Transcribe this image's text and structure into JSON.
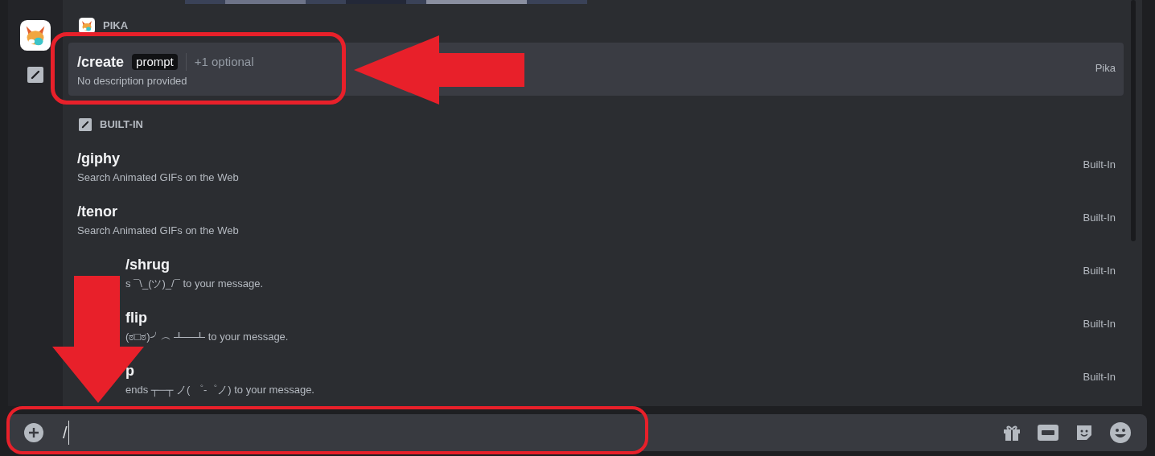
{
  "sections": [
    {
      "title": "PIKA",
      "kind": "app",
      "commands": [
        {
          "name": "/create",
          "option": "prompt",
          "extra": "+1 optional",
          "description": "No description provided",
          "source": "Pika",
          "selected": true,
          "covered": false
        }
      ]
    },
    {
      "title": "BUILT-IN",
      "kind": "builtin",
      "commands": [
        {
          "name": "/giphy",
          "description": "Search Animated GIFs on the Web",
          "source": "Built-In",
          "selected": false,
          "covered": false
        },
        {
          "name": "/tenor",
          "description": "Search Animated GIFs on the Web",
          "source": "Built-In",
          "selected": false,
          "covered": false
        },
        {
          "name": "/shrug",
          "description": "s ¯\\_(ツ)_/¯ to your message.",
          "source": "Built-In",
          "selected": false,
          "covered": true
        },
        {
          "name": "flip",
          "description": "(ಠ□ಠ)╯︵ ┻━┻ to your message.",
          "source": "Built-In",
          "selected": false,
          "covered": true
        },
        {
          "name": "p",
          "description": "ends ┬─┬ ノ( ゜-゜ノ) to your message.",
          "source": "Built-In",
          "selected": false,
          "covered": true
        }
      ]
    }
  ],
  "composer": {
    "value": "/"
  }
}
